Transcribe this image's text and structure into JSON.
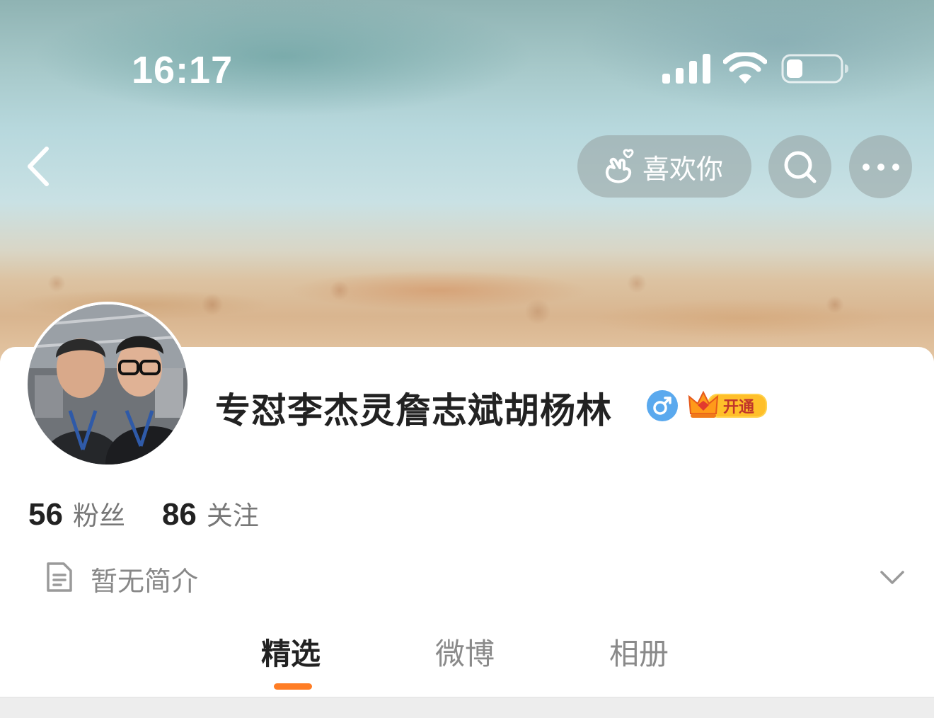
{
  "status_bar": {
    "time": "16:17",
    "signal_icon": "cellular-signal-icon",
    "wifi_icon": "wifi-icon",
    "battery_icon": "battery-icon",
    "battery_level": 0.3
  },
  "nav": {
    "back_icon": "chevron-left-icon",
    "like_label": "喜欢你",
    "like_icon": "finger-heart-icon",
    "search_icon": "search-icon",
    "more_icon": "more-dots-icon"
  },
  "profile": {
    "username": "专怼李杰灵詹志斌胡杨林",
    "gender_symbol": "♂",
    "vip_label": "开通",
    "followers_count": "56",
    "followers_label": "粉丝",
    "following_count": "86",
    "following_label": "关注",
    "bio": "暂无简介"
  },
  "tabs": [
    {
      "label": "精选",
      "active": true
    },
    {
      "label": "微博",
      "active": false
    },
    {
      "label": "相册",
      "active": false
    }
  ],
  "colors": {
    "accent": "#ff7d25",
    "gender_badge": "#5aa9ee",
    "text_primary": "#222222",
    "text_secondary": "#888888"
  }
}
